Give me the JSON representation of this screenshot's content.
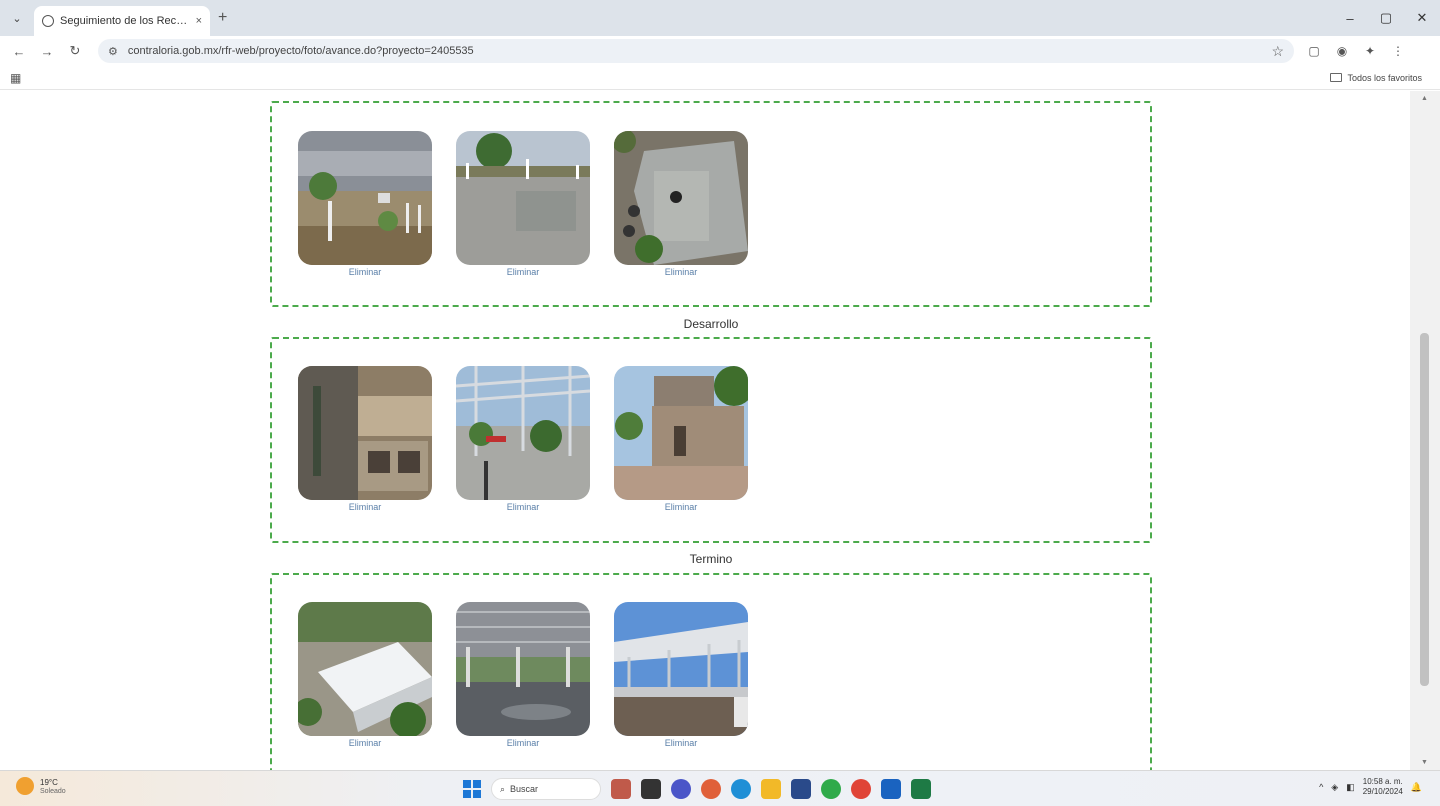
{
  "browser": {
    "tab_title": "Seguimiento de los Recursos P",
    "tab_close": "×",
    "new_tab": "+",
    "url": "contraloria.gob.mx/rfr-web/proyecto/foto/avance.do?proyecto=2405535",
    "bookmarks_label": "Todos los favoritos",
    "window_controls": [
      "–",
      "▢",
      "✕"
    ],
    "nav_icons": [
      "back-icon",
      "forward-icon",
      "reload-icon"
    ]
  },
  "stages": [
    {
      "title": "",
      "photos": [
        {
          "description": "tierra-con-postes",
          "delete_label": "Eliminar"
        },
        {
          "description": "cancha-concreto",
          "delete_label": "Eliminar"
        },
        {
          "description": "vista-aerea-cancha",
          "delete_label": "Eliminar"
        }
      ]
    },
    {
      "title": "Desarrollo",
      "photos": [
        {
          "description": "zapatas-cimentacion",
          "delete_label": "Eliminar"
        },
        {
          "description": "estructura-metalica",
          "delete_label": "Eliminar"
        },
        {
          "description": "caseta-construccion",
          "delete_label": "Eliminar"
        }
      ]
    },
    {
      "title": "Termino",
      "photos": [
        {
          "description": "vista-aerea-techumbre",
          "delete_label": "Eliminar"
        },
        {
          "description": "techumbre-interior",
          "delete_label": "Eliminar"
        },
        {
          "description": "techumbre-exterior",
          "delete_label": "Eliminar"
        }
      ]
    }
  ],
  "colors": {
    "dashed_border": "#4caa4c",
    "link": "#5a7fa8"
  },
  "taskbar": {
    "weather_temp": "19°C",
    "weather_state": "Soleado",
    "search_placeholder": "Buscar",
    "clock_time": "10:58 a. m.",
    "clock_date": "29/10/2024"
  }
}
